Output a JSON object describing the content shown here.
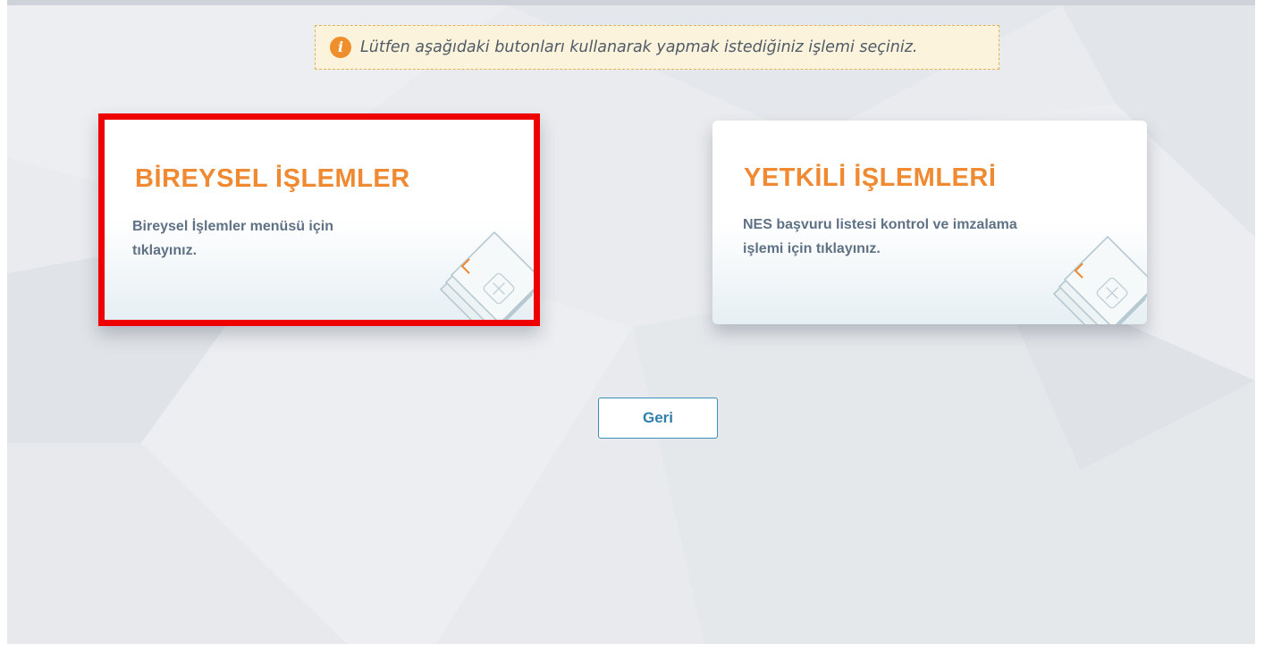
{
  "notice": {
    "icon": "info-icon",
    "icon_glyph": "i",
    "text": "Lütfen aşağıdaki butonları kullanarak yapmak istediğiniz işlemi seçiniz."
  },
  "cards": [
    {
      "title": "BİREYSEL İŞLEMLER",
      "description": "Bireysel İşlemler menüsü için tıklayınız.",
      "icon": "smart-card-icon",
      "highlighted": true
    },
    {
      "title": "YETKİLİ İŞLEMLERİ",
      "description": "NES başvuru listesi kontrol ve imzalama işlemi için tıklayınız.",
      "icon": "smart-card-icon",
      "highlighted": false
    }
  ],
  "back_button": {
    "label": "Geri"
  },
  "colors": {
    "title_accent": "#ef8a32",
    "highlight_border": "#ef0000",
    "button_text": "#2e7fa9",
    "notice_background": "#fcf3dc"
  }
}
